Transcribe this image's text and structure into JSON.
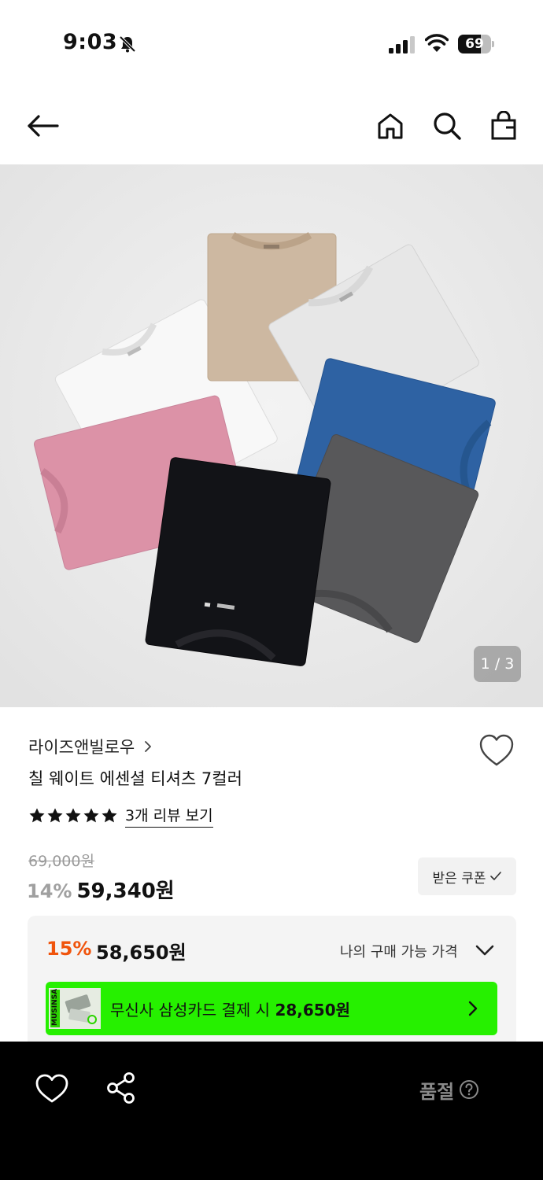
{
  "status_bar": {
    "time": "9:03",
    "battery": "69",
    "battery_level": 0.69
  },
  "nav": {
    "back_icon": "arrow-left-icon",
    "home_icon": "home-icon",
    "search_icon": "search-icon",
    "bag_icon": "shopping-bag-icon"
  },
  "gallery": {
    "counter": "1 / 3",
    "current": 1,
    "total": 3
  },
  "product": {
    "brand": "라이즈앤빌로우",
    "title": "칠 웨이트 에센셜 티셔츠 7컬러",
    "rating_stars": 5,
    "review_link": "3개 리뷰 보기",
    "original_price": "69,000원",
    "discount_rate": "14%",
    "sale_price": "59,340원",
    "coupon_button": "받은 쿠폰"
  },
  "benefit": {
    "discount_rate": "15%",
    "price": "58,650원",
    "label": "나의 구매 가능 가격",
    "card_banner_prefix": "무신사 삼성카드 결제 시",
    "card_banner_price": "28,650원",
    "card_brand": "MUSINSA"
  },
  "bottom_bar": {
    "status": "품절",
    "wish_icon": "heart-outline-icon",
    "share_icon": "share-icon",
    "help_icon": "question-circle-icon"
  },
  "colors": {
    "accent_orange": "#f0540c",
    "banner_green": "#26f000",
    "bottom_bar": "#000000"
  }
}
